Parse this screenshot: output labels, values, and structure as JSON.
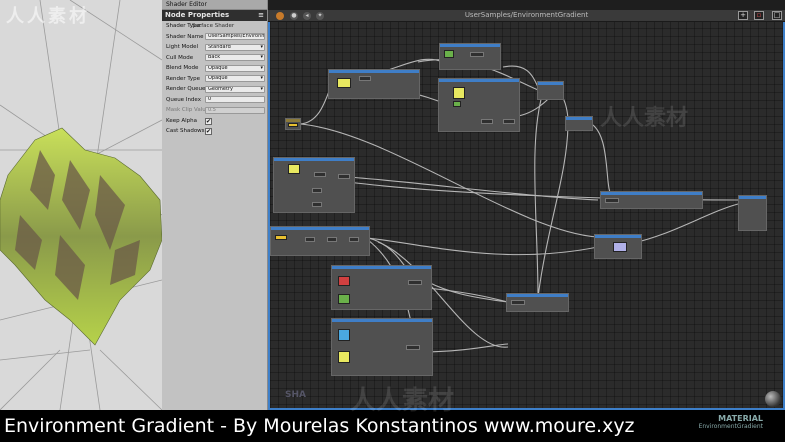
{
  "editor": {
    "tab_label": "Shader Editor",
    "graph_title": "UserSamples/EnvironmentGradient",
    "material_title": "MATERIAL",
    "material_subtitle": "EnvironmentGradient",
    "shader_label": "SHA"
  },
  "properties": {
    "header": "Node Properties",
    "menu_icon": "menu-icon",
    "shader_type_label": "Shader Type:",
    "shader_type_value": "Surface Shader",
    "rows": [
      {
        "label": "Shader Name",
        "value": "UserSamples/Environm",
        "kind": "text"
      },
      {
        "label": "Light Model",
        "value": "Standard",
        "kind": "select"
      },
      {
        "label": "Cull Mode",
        "value": "Back",
        "kind": "select"
      },
      {
        "label": "Blend Mode",
        "value": "Opaque",
        "kind": "select"
      },
      {
        "label": "Render Type",
        "value": "Opaque",
        "kind": "select"
      },
      {
        "label": "Render Queue",
        "value": "Geometry",
        "kind": "select"
      },
      {
        "label": "Queue Index",
        "value": "0",
        "kind": "text"
      },
      {
        "label": "Mask Clip Value",
        "value": "0.5",
        "kind": "disabled"
      },
      {
        "label": "Keep Alpha",
        "value": "✔",
        "kind": "check"
      },
      {
        "label": "Cast Shadows",
        "value": "✔",
        "kind": "check"
      }
    ]
  },
  "watermarks": {
    "left": "人人素材",
    "right": "人人素材",
    "bottom": "人人素材"
  },
  "caption": "Environment Gradient - By Mourelas Konstantinos www.moure.xyz",
  "colors": {
    "accent": "#3f7ec7",
    "terrain_green": "#b8d84a",
    "terrain_brown": "#6b5a48",
    "swatch_red": "#d04040",
    "swatch_green": "#6ab04a",
    "swatch_blue": "#4aa8e0",
    "swatch_yellow": "#e8e860"
  }
}
